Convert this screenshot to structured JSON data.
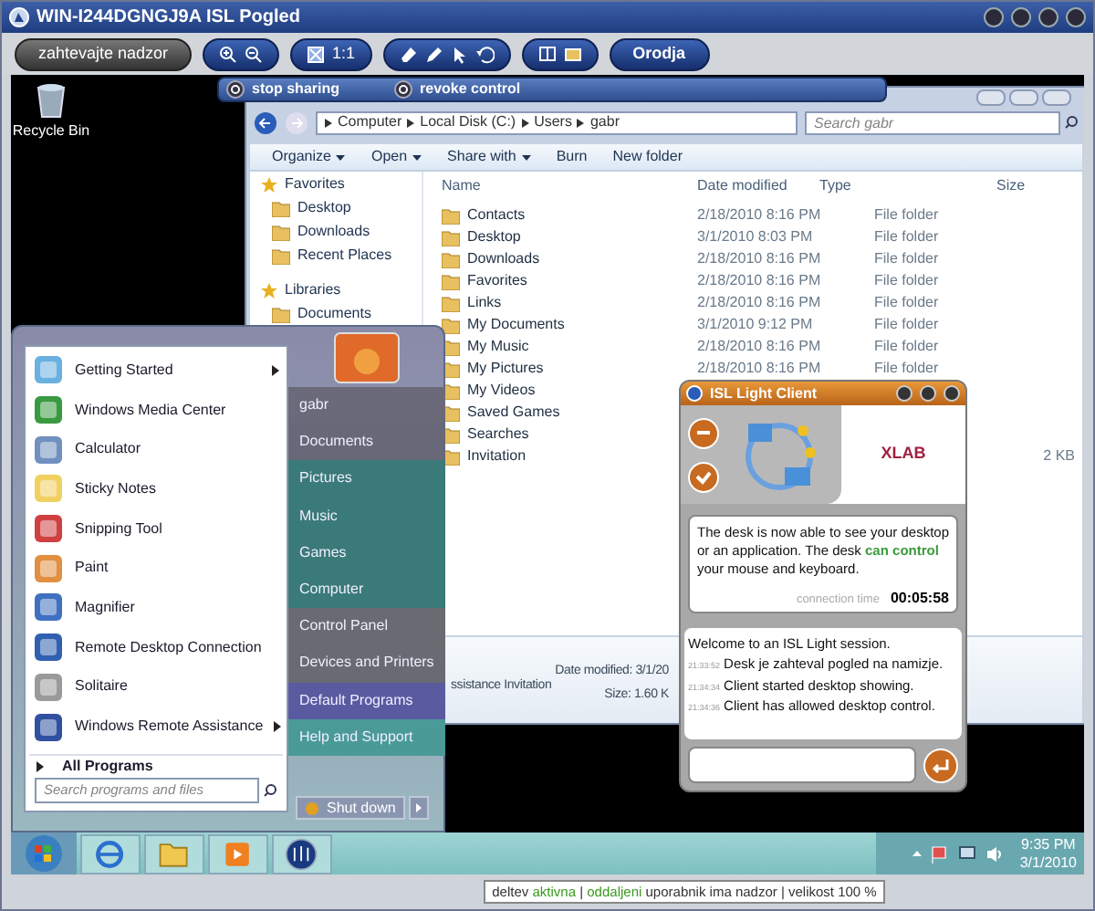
{
  "window": {
    "title": "WIN-I244DGNGJ9A ISL Pogled"
  },
  "toolbar": {
    "request_button": "zahtevajte nadzor",
    "actual_size": "1:1",
    "tools_button": "Orodja"
  },
  "sharing_bar": {
    "buttons": [
      "stop sharing",
      "revoke control"
    ]
  },
  "desktop_icons": [
    {
      "label": "Recycle Bin"
    }
  ],
  "explorer": {
    "breadcrumb": [
      "Computer",
      "Local Disk (C:)",
      "Users",
      "gabr"
    ],
    "search": {
      "placeholder": "Search gabr"
    },
    "commands": [
      {
        "label": "Organize",
        "menu": true
      },
      {
        "label": "Open",
        "menu": true
      },
      {
        "label": "Share with",
        "menu": true
      },
      {
        "label": "Burn",
        "menu": false
      },
      {
        "label": "New folder",
        "menu": false
      }
    ],
    "nav": [
      {
        "label": "Favorites",
        "kind": "group"
      },
      {
        "label": "Desktop",
        "kind": "item"
      },
      {
        "label": "Downloads",
        "kind": "item"
      },
      {
        "label": "Recent Places",
        "kind": "item"
      },
      {
        "label": "Libraries",
        "kind": "group"
      },
      {
        "label": "Documents",
        "kind": "item"
      }
    ],
    "columns": [
      "Name",
      "Date modified",
      "Type",
      "Size"
    ],
    "rows": [
      {
        "name": "Contacts",
        "date": "2/18/2010 8:16 PM",
        "type": "File folder"
      },
      {
        "name": "Desktop",
        "date": "3/1/2010 8:03 PM",
        "type": "File folder"
      },
      {
        "name": "Downloads",
        "date": "2/18/2010 8:16 PM",
        "type": "File folder"
      },
      {
        "name": "Favorites",
        "date": "2/18/2010 8:16 PM",
        "type": "File folder"
      },
      {
        "name": "Links",
        "date": "2/18/2010 8:16 PM",
        "type": "File folder"
      },
      {
        "name": "My Documents",
        "date": "3/1/2010 9:12 PM",
        "type": "File folder"
      },
      {
        "name": "My Music",
        "date": "2/18/2010 8:16 PM",
        "type": "File folder"
      },
      {
        "name": "My Pictures",
        "date": "2/18/2010 8:16 PM",
        "type": "File folder"
      },
      {
        "name": "My Videos"
      },
      {
        "name": "Saved Games"
      },
      {
        "name": "Searches"
      },
      {
        "name": "Invitation",
        "size": "2 KB"
      }
    ],
    "details": {
      "name": "ssistance Invitation",
      "date": "Date modified: 3/1/20",
      "size": "Size: 1.60 K"
    }
  },
  "start_menu": {
    "programs": [
      {
        "label": "Getting Started",
        "submenu": true
      },
      {
        "label": "Windows Media Center",
        "submenu": false
      },
      {
        "label": "Calculator",
        "submenu": false
      },
      {
        "label": "Sticky Notes",
        "submenu": false
      },
      {
        "label": "Snipping Tool",
        "submenu": false
      },
      {
        "label": "Paint",
        "submenu": false
      },
      {
        "label": "Magnifier",
        "submenu": false
      },
      {
        "label": "Remote Desktop Connection",
        "submenu": false
      },
      {
        "label": "Solitaire",
        "submenu": false
      },
      {
        "label": "Windows Remote Assistance",
        "submenu": true
      }
    ],
    "all_programs": "All Programs",
    "search": {
      "placeholder": "Search programs and files"
    },
    "places": [
      "gabr",
      "Documents",
      "Pictures",
      "Music",
      "Games",
      "Computer",
      "Control Panel",
      "Devices and Printers",
      "Default Programs",
      "Help and Support"
    ],
    "shutdown": "Shut down"
  },
  "taskbar": {
    "time": "9:35 PM",
    "date": "3/1/2010"
  },
  "isl_client": {
    "title": "ISL Light Client",
    "logo": "XLAB",
    "message": [
      {
        "text": "The desk is now able to see your desktop or an application. The desk ",
        "highlight": false
      },
      {
        "text": "can control",
        "highlight": true
      },
      {
        "text": " your mouse and keyboard.",
        "highlight": false
      }
    ],
    "connection_label": "connection time",
    "connection_time": "00:05:58",
    "chat": [
      {
        "text": "Welcome to an ISL Light session."
      },
      {
        "time": "21:33:52",
        "text": "Desk je zahteval pogled na namizje."
      },
      {
        "time": "21:34:34",
        "text": "Client started desktop showing."
      },
      {
        "time": "21:34:36",
        "text": "Client has allowed desktop control."
      }
    ]
  },
  "status_bar": [
    {
      "text": "deltev ",
      "highlight": false
    },
    {
      "text": "aktivna",
      "highlight": true
    },
    {
      "text": " | ",
      "highlight": false
    },
    {
      "text": "oddaljeni",
      "highlight": true
    },
    {
      "text": " uporabnik ima nadzor | velikost 100 %",
      "highlight": false
    }
  ]
}
